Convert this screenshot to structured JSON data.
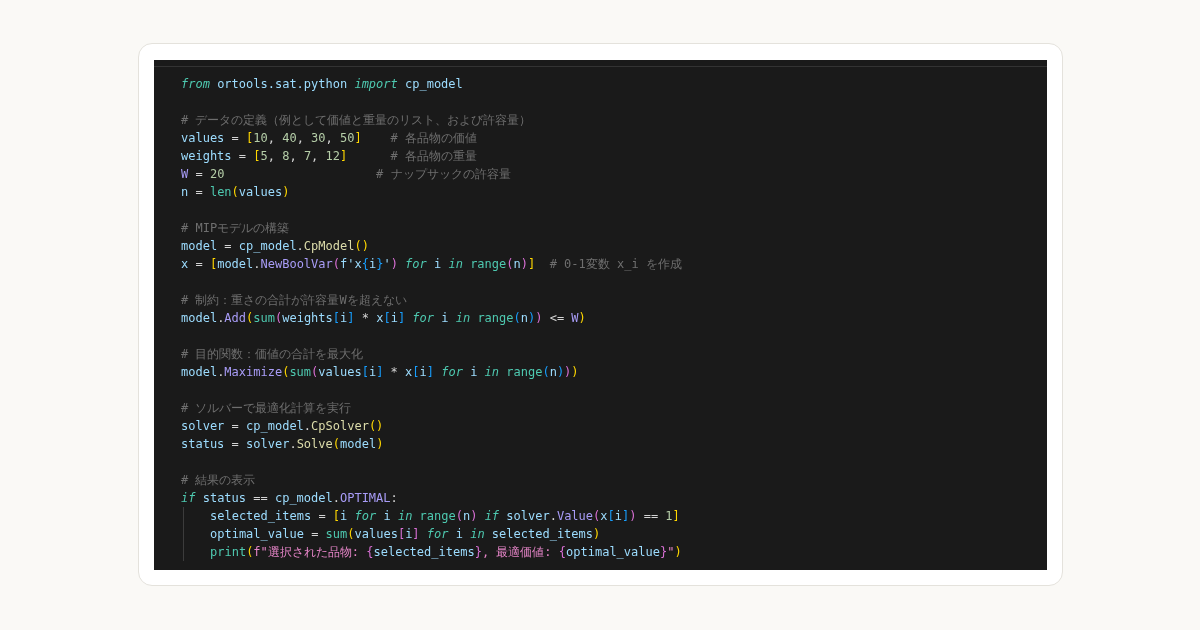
{
  "code_block": {
    "lines": [
      {
        "kind": "code",
        "tokens": [
          {
            "text": "from",
            "kind": "kw"
          },
          {
            "text": " ortools.sat.python",
            "kind": "var"
          },
          {
            "text": " import",
            "kind": "kw"
          },
          {
            "text": " cp_model",
            "kind": "var"
          }
        ]
      },
      {
        "kind": "blank"
      },
      {
        "kind": "code",
        "tokens": [
          {
            "text": "# データの定義（例として価値と重量のリスト、および許容量）",
            "kind": "cmt"
          }
        ]
      },
      {
        "kind": "code",
        "tokens": [
          {
            "text": "values",
            "kind": "var"
          },
          {
            "text": " = ",
            "kind": "op"
          },
          {
            "text": "[",
            "kind": "b1"
          },
          {
            "text": "10",
            "kind": "num"
          },
          {
            "text": ", ",
            "kind": "op"
          },
          {
            "text": "40",
            "kind": "num"
          },
          {
            "text": ", ",
            "kind": "op"
          },
          {
            "text": "30",
            "kind": "num"
          },
          {
            "text": ", ",
            "kind": "op"
          },
          {
            "text": "50",
            "kind": "num"
          },
          {
            "text": "]",
            "kind": "b1"
          },
          {
            "text": "    # 各品物の価値",
            "kind": "cmt"
          }
        ]
      },
      {
        "kind": "code",
        "tokens": [
          {
            "text": "weights",
            "kind": "var"
          },
          {
            "text": " = ",
            "kind": "op"
          },
          {
            "text": "[",
            "kind": "b1"
          },
          {
            "text": "5",
            "kind": "num"
          },
          {
            "text": ", ",
            "kind": "op"
          },
          {
            "text": "8",
            "kind": "num"
          },
          {
            "text": ", ",
            "kind": "op"
          },
          {
            "text": "7",
            "kind": "num"
          },
          {
            "text": ", ",
            "kind": "op"
          },
          {
            "text": "12",
            "kind": "num"
          },
          {
            "text": "]",
            "kind": "b1"
          },
          {
            "text": "      # 各品物の重量",
            "kind": "cmt"
          }
        ]
      },
      {
        "kind": "code",
        "tokens": [
          {
            "text": "W",
            "kind": "const"
          },
          {
            "text": " = ",
            "kind": "op"
          },
          {
            "text": "20",
            "kind": "num"
          },
          {
            "text": "                     # ナップサックの許容量",
            "kind": "cmt"
          }
        ]
      },
      {
        "kind": "code",
        "tokens": [
          {
            "text": "n",
            "kind": "var"
          },
          {
            "text": " = ",
            "kind": "op"
          },
          {
            "text": "len",
            "kind": "fn"
          },
          {
            "text": "(",
            "kind": "b1"
          },
          {
            "text": "values",
            "kind": "var"
          },
          {
            "text": ")",
            "kind": "b1"
          }
        ]
      },
      {
        "kind": "blank"
      },
      {
        "kind": "code",
        "tokens": [
          {
            "text": "# MIPモデルの構築",
            "kind": "cmt"
          }
        ]
      },
      {
        "kind": "code",
        "tokens": [
          {
            "text": "model",
            "kind": "var"
          },
          {
            "text": " = ",
            "kind": "op"
          },
          {
            "text": "cp_model",
            "kind": "var"
          },
          {
            "text": ".",
            "kind": "op"
          },
          {
            "text": "CpModel",
            "kind": "cls"
          },
          {
            "text": "()",
            "kind": "b1"
          }
        ]
      },
      {
        "kind": "code",
        "tokens": [
          {
            "text": "x",
            "kind": "var"
          },
          {
            "text": " = ",
            "kind": "op"
          },
          {
            "text": "[",
            "kind": "b1"
          },
          {
            "text": "model",
            "kind": "var"
          },
          {
            "text": ".",
            "kind": "op"
          },
          {
            "text": "NewBoolVar",
            "kind": "meth"
          },
          {
            "text": "(",
            "kind": "b2"
          },
          {
            "text": "f'x",
            "kind": "var"
          },
          {
            "text": "{",
            "kind": "b3"
          },
          {
            "text": "i",
            "kind": "var"
          },
          {
            "text": "}",
            "kind": "b3"
          },
          {
            "text": "'",
            "kind": "var"
          },
          {
            "text": ")",
            "kind": "b2"
          },
          {
            "text": " for",
            "kind": "kw"
          },
          {
            "text": " i ",
            "kind": "var"
          },
          {
            "text": "in",
            "kind": "kw"
          },
          {
            "text": " range",
            "kind": "fn"
          },
          {
            "text": "(",
            "kind": "b2"
          },
          {
            "text": "n",
            "kind": "var"
          },
          {
            "text": ")",
            "kind": "b2"
          },
          {
            "text": "]",
            "kind": "b1"
          },
          {
            "text": "  # 0-1変数 x_i を作成",
            "kind": "cmt"
          }
        ]
      },
      {
        "kind": "blank"
      },
      {
        "kind": "code",
        "tokens": [
          {
            "text": "# 制約：重さの合計が許容量Wを超えない",
            "kind": "cmt"
          }
        ]
      },
      {
        "kind": "code",
        "tokens": [
          {
            "text": "model",
            "kind": "var"
          },
          {
            "text": ".",
            "kind": "op"
          },
          {
            "text": "Add",
            "kind": "meth"
          },
          {
            "text": "(",
            "kind": "b1"
          },
          {
            "text": "sum",
            "kind": "fn"
          },
          {
            "text": "(",
            "kind": "b2"
          },
          {
            "text": "weights",
            "kind": "var"
          },
          {
            "text": "[",
            "kind": "b3"
          },
          {
            "text": "i",
            "kind": "var"
          },
          {
            "text": "]",
            "kind": "b3"
          },
          {
            "text": " * ",
            "kind": "op"
          },
          {
            "text": "x",
            "kind": "var"
          },
          {
            "text": "[",
            "kind": "b3"
          },
          {
            "text": "i",
            "kind": "var"
          },
          {
            "text": "]",
            "kind": "b3"
          },
          {
            "text": " for",
            "kind": "kw"
          },
          {
            "text": " i ",
            "kind": "var"
          },
          {
            "text": "in",
            "kind": "kw"
          },
          {
            "text": " range",
            "kind": "fn"
          },
          {
            "text": "(",
            "kind": "b3"
          },
          {
            "text": "n",
            "kind": "var"
          },
          {
            "text": ")",
            "kind": "b3"
          },
          {
            "text": ")",
            "kind": "b2"
          },
          {
            "text": " <= ",
            "kind": "op"
          },
          {
            "text": "W",
            "kind": "const"
          },
          {
            "text": ")",
            "kind": "b1"
          }
        ]
      },
      {
        "kind": "blank"
      },
      {
        "kind": "code",
        "tokens": [
          {
            "text": "# 目的関数：価値の合計を最大化",
            "kind": "cmt"
          }
        ]
      },
      {
        "kind": "code",
        "tokens": [
          {
            "text": "model",
            "kind": "var"
          },
          {
            "text": ".",
            "kind": "op"
          },
          {
            "text": "Maximize",
            "kind": "meth"
          },
          {
            "text": "(",
            "kind": "b1"
          },
          {
            "text": "sum",
            "kind": "fn"
          },
          {
            "text": "(",
            "kind": "b2"
          },
          {
            "text": "values",
            "kind": "var"
          },
          {
            "text": "[",
            "kind": "b3"
          },
          {
            "text": "i",
            "kind": "var"
          },
          {
            "text": "]",
            "kind": "b3"
          },
          {
            "text": " * ",
            "kind": "op"
          },
          {
            "text": "x",
            "kind": "var"
          },
          {
            "text": "[",
            "kind": "b3"
          },
          {
            "text": "i",
            "kind": "var"
          },
          {
            "text": "]",
            "kind": "b3"
          },
          {
            "text": " for",
            "kind": "kw"
          },
          {
            "text": " i ",
            "kind": "var"
          },
          {
            "text": "in",
            "kind": "kw"
          },
          {
            "text": " range",
            "kind": "fn"
          },
          {
            "text": "(",
            "kind": "b3"
          },
          {
            "text": "n",
            "kind": "var"
          },
          {
            "text": ")",
            "kind": "b3"
          },
          {
            "text": ")",
            "kind": "b2"
          },
          {
            "text": ")",
            "kind": "b1"
          }
        ]
      },
      {
        "kind": "blank"
      },
      {
        "kind": "code",
        "tokens": [
          {
            "text": "# ソルバーで最適化計算を実行",
            "kind": "cmt"
          }
        ]
      },
      {
        "kind": "code",
        "tokens": [
          {
            "text": "solver",
            "kind": "var"
          },
          {
            "text": " = ",
            "kind": "op"
          },
          {
            "text": "cp_model",
            "kind": "var"
          },
          {
            "text": ".",
            "kind": "op"
          },
          {
            "text": "CpSolver",
            "kind": "cls"
          },
          {
            "text": "()",
            "kind": "b1"
          }
        ]
      },
      {
        "kind": "code",
        "tokens": [
          {
            "text": "status",
            "kind": "var"
          },
          {
            "text": " = ",
            "kind": "op"
          },
          {
            "text": "solver",
            "kind": "var"
          },
          {
            "text": ".",
            "kind": "op"
          },
          {
            "text": "Solve",
            "kind": "cls"
          },
          {
            "text": "(",
            "kind": "b1"
          },
          {
            "text": "model",
            "kind": "var"
          },
          {
            "text": ")",
            "kind": "b1"
          }
        ]
      },
      {
        "kind": "blank"
      },
      {
        "kind": "code",
        "tokens": [
          {
            "text": "# 結果の表示",
            "kind": "cmt"
          }
        ]
      },
      {
        "kind": "code",
        "tokens": [
          {
            "text": "if",
            "kind": "kw"
          },
          {
            "text": " status",
            "kind": "var"
          },
          {
            "text": " == ",
            "kind": "op"
          },
          {
            "text": "cp_model",
            "kind": "var"
          },
          {
            "text": ".",
            "kind": "op"
          },
          {
            "text": "OPTIMAL",
            "kind": "const"
          },
          {
            "text": ":",
            "kind": "op"
          }
        ],
        "children": [
          {
            "kind": "code",
            "tokens": [
              {
                "text": "selected_items",
                "kind": "var"
              },
              {
                "text": " = ",
                "kind": "op"
              },
              {
                "text": "[",
                "kind": "b1"
              },
              {
                "text": "i",
                "kind": "var"
              },
              {
                "text": " for",
                "kind": "kw"
              },
              {
                "text": " i ",
                "kind": "var"
              },
              {
                "text": "in",
                "kind": "kw"
              },
              {
                "text": " range",
                "kind": "fn"
              },
              {
                "text": "(",
                "kind": "b2"
              },
              {
                "text": "n",
                "kind": "var"
              },
              {
                "text": ")",
                "kind": "b2"
              },
              {
                "text": " if",
                "kind": "kw"
              },
              {
                "text": " solver",
                "kind": "var"
              },
              {
                "text": ".",
                "kind": "op"
              },
              {
                "text": "Value",
                "kind": "meth"
              },
              {
                "text": "(",
                "kind": "b2"
              },
              {
                "text": "x",
                "kind": "var"
              },
              {
                "text": "[",
                "kind": "b3"
              },
              {
                "text": "i",
                "kind": "var"
              },
              {
                "text": "]",
                "kind": "b3"
              },
              {
                "text": ")",
                "kind": "b2"
              },
              {
                "text": " == ",
                "kind": "op"
              },
              {
                "text": "1",
                "kind": "num"
              },
              {
                "text": "]",
                "kind": "b1"
              }
            ]
          },
          {
            "kind": "code",
            "tokens": [
              {
                "text": "optimal_value",
                "kind": "var"
              },
              {
                "text": " = ",
                "kind": "op"
              },
              {
                "text": "sum",
                "kind": "fn"
              },
              {
                "text": "(",
                "kind": "b1"
              },
              {
                "text": "values",
                "kind": "var"
              },
              {
                "text": "[",
                "kind": "b2"
              },
              {
                "text": "i",
                "kind": "var"
              },
              {
                "text": "]",
                "kind": "b2"
              },
              {
                "text": " for",
                "kind": "kw"
              },
              {
                "text": " i ",
                "kind": "var"
              },
              {
                "text": "in",
                "kind": "kw"
              },
              {
                "text": " selected_items",
                "kind": "var"
              },
              {
                "text": ")",
                "kind": "b1"
              }
            ]
          },
          {
            "kind": "code",
            "tokens": [
              {
                "text": "print",
                "kind": "fn"
              },
              {
                "text": "(",
                "kind": "b1"
              },
              {
                "text": "f\"選択された品物: ",
                "kind": "str"
              },
              {
                "text": "{",
                "kind": "b2"
              },
              {
                "text": "selected_items",
                "kind": "var"
              },
              {
                "text": "}",
                "kind": "b2"
              },
              {
                "text": ", 最適価値: ",
                "kind": "str"
              },
              {
                "text": "{",
                "kind": "b2"
              },
              {
                "text": "optimal_value",
                "kind": "var"
              },
              {
                "text": "}",
                "kind": "b2"
              },
              {
                "text": "\"",
                "kind": "str"
              },
              {
                "text": ")",
                "kind": "b1"
              }
            ]
          }
        ]
      }
    ]
  }
}
